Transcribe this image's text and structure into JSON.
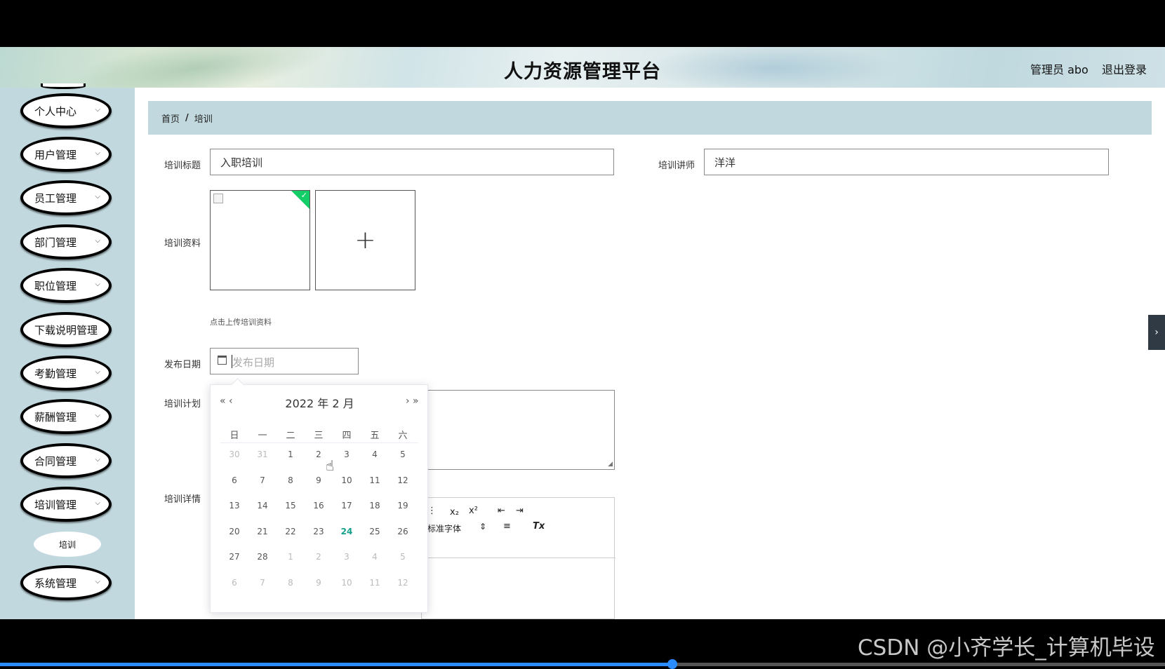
{
  "header": {
    "title": "人力资源管理平台",
    "user": "管理员 abo",
    "logout": "退出登录"
  },
  "sidebar": {
    "items": [
      {
        "label": "个人中心"
      },
      {
        "label": "用户管理"
      },
      {
        "label": "员工管理"
      },
      {
        "label": "部门管理"
      },
      {
        "label": "职位管理"
      },
      {
        "label": "下载说明管理"
      },
      {
        "label": "考勤管理"
      },
      {
        "label": "薪酬管理"
      },
      {
        "label": "合同管理"
      },
      {
        "label": "培训管理"
      },
      {
        "label": "系统管理"
      }
    ],
    "sub_item": "培训"
  },
  "breadcrumb": {
    "home": "首页",
    "separator": "/",
    "current": "培训"
  },
  "form": {
    "title_label": "培训标题",
    "title_value": "入职培训",
    "lecturer_label": "培训讲师",
    "lecturer_value": "洋洋",
    "material_label": "培训资料",
    "upload_add": "+",
    "upload_tip": "点击上传培训资料",
    "date_label": "发布日期",
    "date_placeholder": "发布日期",
    "plan_label": "培训计划",
    "detail_label": "培训详情",
    "editor": {
      "font_select": "标准字体",
      "font_select_arrow": "⇕",
      "subscript": "x₂",
      "superscript": "x²",
      "list_dots": "⋮",
      "outdent": "⇤",
      "indent": "⇥",
      "align": "≡",
      "clear": "Tx"
    }
  },
  "datepicker": {
    "year_label": "2022 年",
    "month_label": "2 月",
    "prev_year": "«",
    "prev_month": "‹",
    "next_month": "›",
    "next_year": "»",
    "weekdays": [
      "日",
      "一",
      "二",
      "三",
      "四",
      "五",
      "六"
    ],
    "weeks": [
      [
        "30",
        "31",
        "1",
        "2",
        "3",
        "4",
        "5"
      ],
      [
        "6",
        "7",
        "8",
        "9",
        "10",
        "11",
        "12"
      ],
      [
        "13",
        "14",
        "15",
        "16",
        "17",
        "18",
        "19"
      ],
      [
        "20",
        "21",
        "22",
        "23",
        "24",
        "25",
        "26"
      ],
      [
        "27",
        "28",
        "1",
        "2",
        "3",
        "4",
        "5"
      ],
      [
        "6",
        "7",
        "8",
        "9",
        "10",
        "11",
        "12"
      ]
    ],
    "today": "24"
  },
  "side_handle": "›",
  "watermark": "CSDN @小齐学长_计算机毕设",
  "video_progress": 0.577,
  "colors": {
    "sidebar_bg": "#c1d8de",
    "accent_today": "#13a08a",
    "upload_success": "#13ce66"
  }
}
